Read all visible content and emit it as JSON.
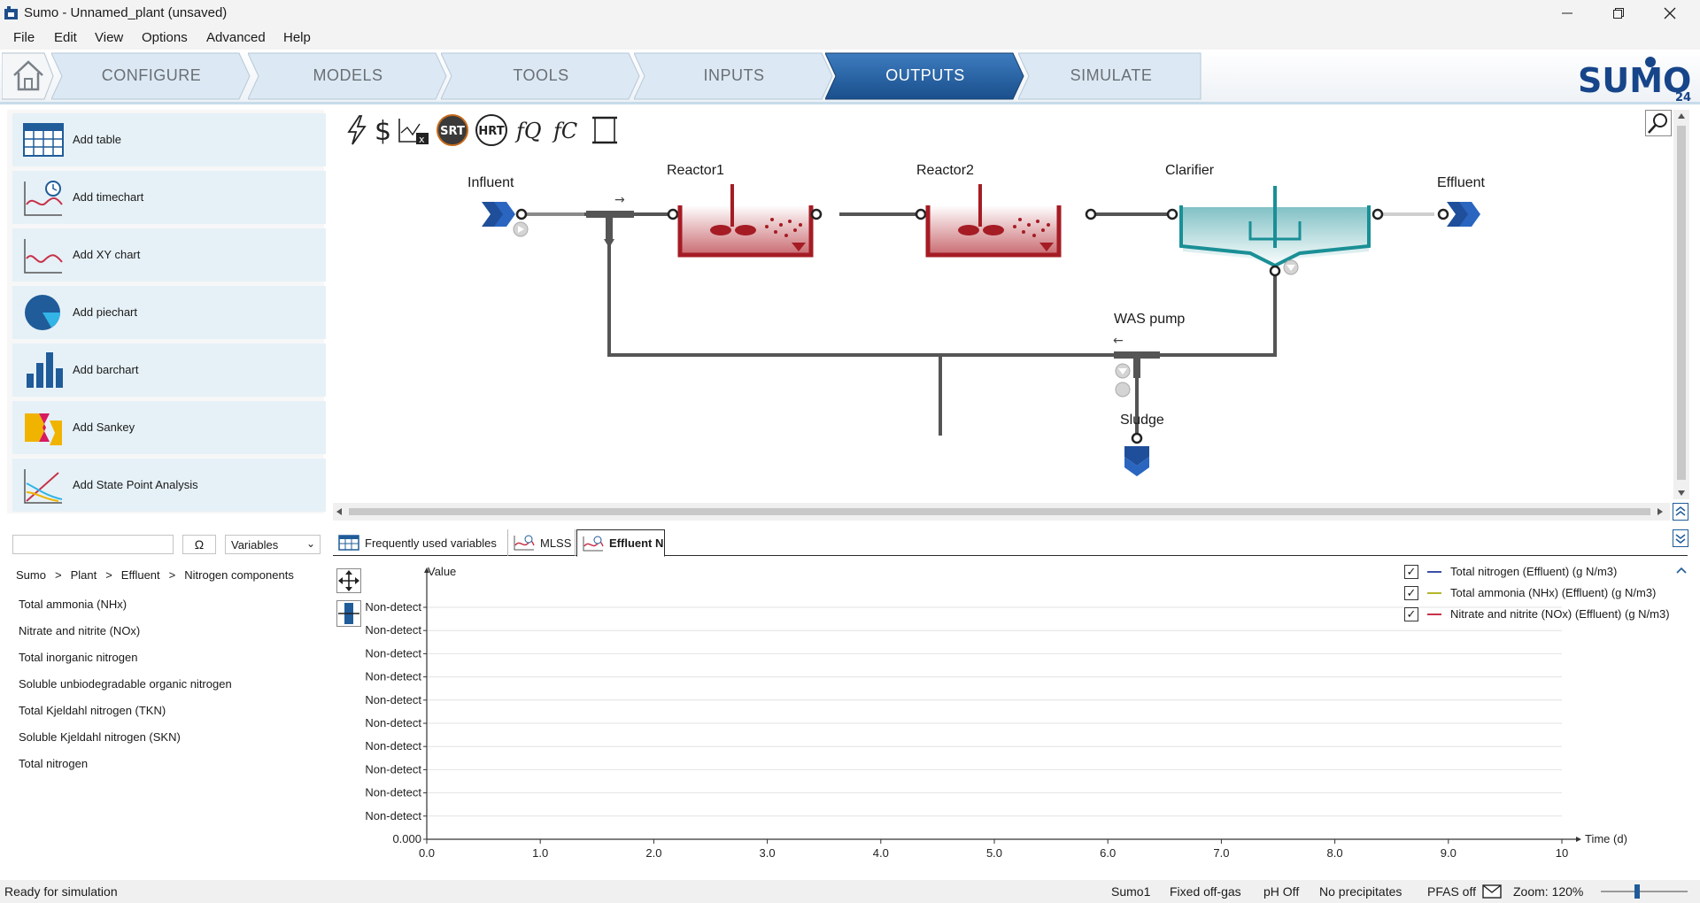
{
  "window": {
    "title": "Sumo - Unnamed_plant (unsaved)"
  },
  "menu": [
    {
      "label": "File"
    },
    {
      "label": "Edit"
    },
    {
      "label": "View"
    },
    {
      "label": "Options"
    },
    {
      "label": "Advanced"
    },
    {
      "label": "Help"
    }
  ],
  "ribbon": {
    "tabs": [
      {
        "label": "CONFIGURE"
      },
      {
        "label": "MODELS"
      },
      {
        "label": "TOOLS"
      },
      {
        "label": "INPUTS"
      },
      {
        "label": "OUTPUTS",
        "active": true
      },
      {
        "label": "SIMULATE"
      }
    ],
    "logo_text": "SUMO",
    "logo_version": "24"
  },
  "add_panel": [
    {
      "label": "Add table"
    },
    {
      "label": "Add timechart"
    },
    {
      "label": "Add XY chart"
    },
    {
      "label": "Add piechart"
    },
    {
      "label": "Add barchart"
    },
    {
      "label": "Add Sankey"
    },
    {
      "label": "Add State Point Analysis"
    }
  ],
  "flowsheet": {
    "units": {
      "influent": "Influent",
      "reactor1": "Reactor1",
      "reactor2": "Reactor2",
      "clarifier": "Clarifier",
      "effluent": "Effluent",
      "was_pump": "WAS pump",
      "sludge": "Sludge"
    },
    "toolbar": [
      "lightning-icon",
      "dollar-icon",
      "chart-x-icon",
      "SRT",
      "HRT",
      "fQ",
      "fC",
      "scroll-icon"
    ],
    "srt_label": "SRT",
    "hrt_label": "HRT"
  },
  "variables": {
    "search_placeholder": "",
    "omega_label": "Ω",
    "selector_value": "Variables",
    "breadcrumb": [
      "Sumo",
      "Plant",
      "Effluent",
      "Nitrogen components"
    ],
    "breadcrumb_sep": ">",
    "items": [
      "Total ammonia (NHx)",
      "Nitrate and nitrite (NOx)",
      "Total inorganic nitrogen",
      "Soluble unbiodegradable organic nitrogen",
      "Total Kjeldahl nitrogen (TKN)",
      "Soluble Kjeldahl nitrogen (SKN)",
      "Total nitrogen"
    ]
  },
  "output_tabs": [
    {
      "label": "Frequently used variables"
    },
    {
      "label": "MLSS"
    },
    {
      "label": "Effluent N",
      "active": true
    }
  ],
  "chart_data": {
    "type": "line",
    "ylabel": "Value",
    "xlabel": "Time  (d)",
    "xlim": [
      0,
      10
    ],
    "x_ticks": [
      "0.0",
      "1.0",
      "2.0",
      "3.0",
      "4.0",
      "5.0",
      "6.0",
      "7.0",
      "8.0",
      "9.0",
      "10"
    ],
    "y_ticks": [
      "0.000",
      "Non-detect",
      "Non-detect",
      "Non-detect",
      "Non-detect",
      "Non-detect",
      "Non-detect",
      "Non-detect",
      "Non-detect",
      "Non-detect",
      "Non-detect"
    ],
    "grid": true,
    "legend_position": "top-right",
    "series": [
      {
        "name": "Total nitrogen (Effluent) (g N/m3)",
        "color": "#3b4fa8",
        "checked": true,
        "values": []
      },
      {
        "name": "Total ammonia (NHx) (Effluent) (g N/m3)",
        "color": "#b5b52a",
        "checked": true,
        "values": []
      },
      {
        "name": "Nitrate and nitrite (NOx) (Effluent) (g N/m3)",
        "color": "#c8324a",
        "checked": true,
        "values": []
      }
    ]
  },
  "status": {
    "left": "Ready for simulation",
    "items": [
      "Sumo1",
      "Fixed off-gas",
      "pH Off",
      "No precipitates",
      "PFAS off"
    ],
    "zoom": "Zoom: 120%"
  },
  "colors": {
    "accent": "#1f5c99",
    "reactor": "#a51c24",
    "clarifier": "#1a8f96",
    "panel_button": "#e6f1f7"
  }
}
